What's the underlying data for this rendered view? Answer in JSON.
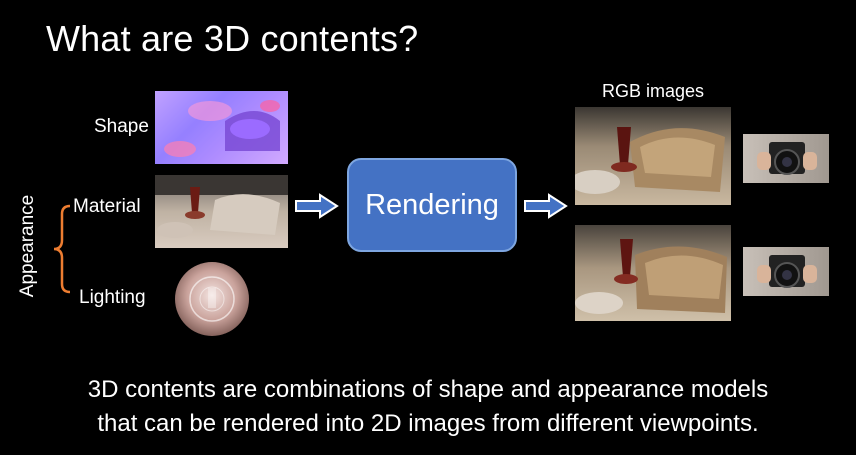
{
  "slide": {
    "title": "What are 3D contents?",
    "labels": {
      "shape": "Shape",
      "material": "Material",
      "lighting": "Lighting",
      "appearance": "Appearance",
      "rgb_images": "RGB images"
    },
    "rendering_box": "Rendering",
    "caption_line1": "3D contents are combinations of shape and appearance models",
    "caption_line2": "that can be rendered into 2D images from different viewpoints."
  },
  "colors": {
    "background": "#000000",
    "rendering_box": "#4472c4",
    "arrow_fill": "#4472c4",
    "arrow_stroke": "#ffffff",
    "bracket": "#ed7d31"
  }
}
